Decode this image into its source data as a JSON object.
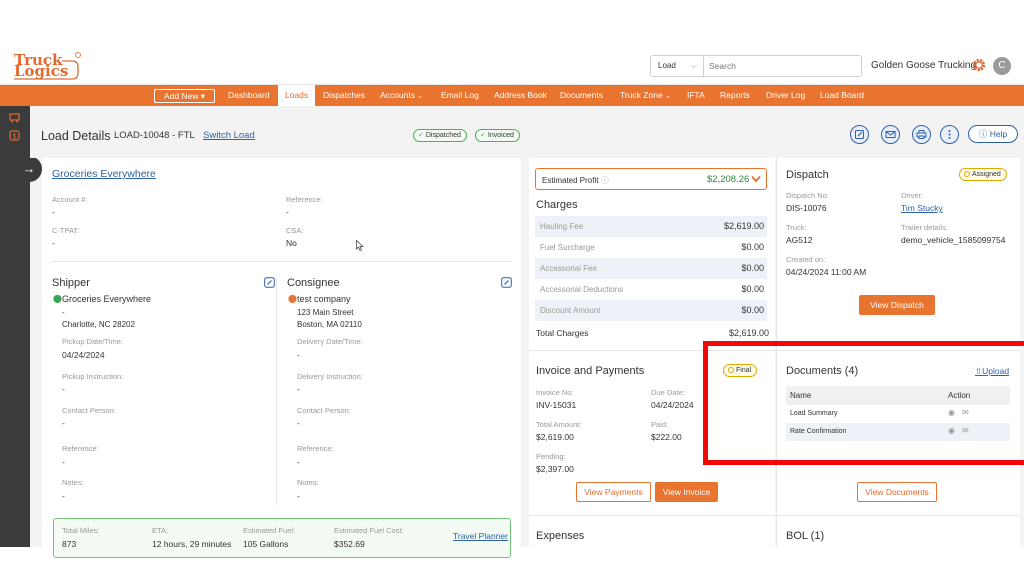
{
  "header": {
    "logo_line1": "Truck",
    "logo_line2": "Logics",
    "search_type": "Load",
    "search_placeholder": "Search",
    "company": "Golden Goose Trucking",
    "avatar_initial": "C"
  },
  "nav": {
    "add_new": "Add New",
    "items": [
      "Dashboard",
      "Loads",
      "Dispatches",
      "Accounts",
      "Email Log",
      "Address Book",
      "Documents",
      "Truck Zone",
      "IFTA",
      "Reports",
      "Driver Log",
      "Load Board"
    ],
    "active": "Loads"
  },
  "load": {
    "title": "Load Details",
    "id": "LOAD-10048 - FTL",
    "switch": "Switch Load",
    "badges": [
      "Dispatched",
      "Invoiced"
    ],
    "help": "Help"
  },
  "customer": {
    "name": "Groceries Everywhere",
    "account_label": "Account #:",
    "account": "-",
    "reference_label": "Reference:",
    "reference": "-",
    "ctpat_label": "C-TPAT:",
    "ctpat": "-",
    "csa_label": "CSA:",
    "csa": "No"
  },
  "shipper": {
    "title": "Shipper",
    "name": "Groceries Everywhere",
    "line2": "-",
    "city": "Charlotte, NC 28202",
    "date_label": "Pickup Date/Time:",
    "date": "04/24/2024",
    "instr_label": "Pickup Instruction:",
    "instr": "-",
    "contact_label": "Contact Person:",
    "contact": "-",
    "ref_label": "Reference:",
    "ref": "-",
    "notes_label": "Notes:",
    "notes": "-"
  },
  "consignee": {
    "title": "Consignee",
    "name": "test company",
    "street": "123 Main Street",
    "city": "Boston, MA 02110",
    "date_label": "Delivery Date/Time:",
    "date": "-",
    "instr_label": "Delivery Instruction:",
    "instr": "-",
    "contact_label": "Contact Person:",
    "contact": "-",
    "ref_label": "Reference:",
    "ref": "-",
    "notes_label": "Notes:",
    "notes": "-"
  },
  "trip": {
    "miles_label": "Total Miles:",
    "miles": "873",
    "eta_label": "ETA:",
    "eta": "12 hours, 29 minutes",
    "fuel_label": "Estimated Fuel:",
    "fuel": "105 Gallons",
    "cost_label": "Estimated Fuel Cost:",
    "cost": "$352.69",
    "planner": "Travel Planner"
  },
  "profit": {
    "label": "Estimated Profit",
    "value": "$2,208.26"
  },
  "charges": {
    "title": "Charges",
    "rows": [
      {
        "label": "Hauling Fee",
        "value": "$2,619.00"
      },
      {
        "label": "Fuel Surcharge",
        "value": "$0.00"
      },
      {
        "label": "Accessorial Fee",
        "value": "$0.00"
      },
      {
        "label": "Accessorial Deductions",
        "value": "$0.00"
      },
      {
        "label": "Discount Amount",
        "value": "$0.00"
      }
    ],
    "total_label": "Total Charges",
    "total": "$2,619.00"
  },
  "invoice": {
    "title": "Invoice and Payments",
    "status": "Final",
    "no_label": "Invoice No:",
    "no": "INV-15031",
    "due_label": "Due Date:",
    "due": "04/24/2024",
    "amount_label": "Total Amount:",
    "amount": "$2,619.00",
    "paid_label": "Paid:",
    "paid": "$222.00",
    "pending_label": "Pending:",
    "pending": "$2,397.00",
    "view_payments": "View Payments",
    "view_invoice": "View Invoice"
  },
  "expenses": {
    "title": "Expenses"
  },
  "dispatch": {
    "title": "Dispatch",
    "status": "Assigned",
    "no_label": "Dispatch No:",
    "no": "DIS-10076",
    "driver_label": "Driver:",
    "driver": "Tim Stucky",
    "truck_label": "Truck:",
    "truck": "AG512",
    "trailer_label": "Trailer details:",
    "trailer": "demo_vehicle_1585099754",
    "created_label": "Created on:",
    "created": "04/24/2024 11:00 AM",
    "button": "View Dispatch"
  },
  "documents": {
    "title": "Documents (4)",
    "upload": "Upload",
    "col_name": "Name",
    "col_action": "Action",
    "rows": [
      "Load Summary",
      "Rate Confirmation"
    ],
    "button": "View Documents"
  },
  "bol": {
    "title": "BOL (1)"
  },
  "colors": {
    "brand": "#e8742f",
    "link": "#2d61a8",
    "highlight": "#f30707"
  }
}
